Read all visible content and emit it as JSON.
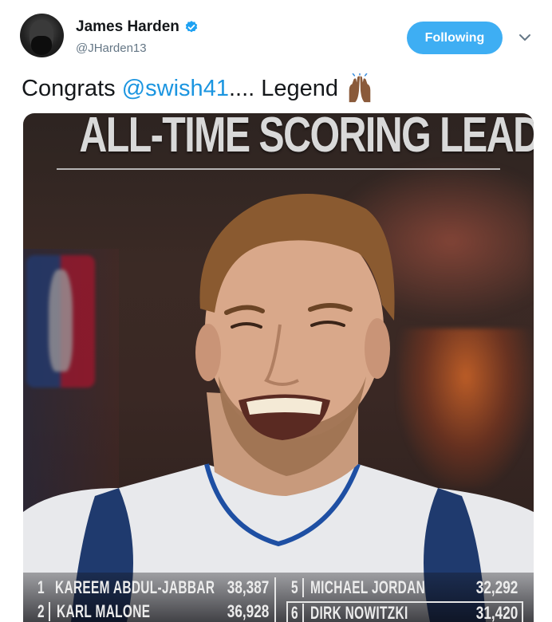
{
  "tweet": {
    "author_name": "James Harden",
    "author_handle": "@JHarden13",
    "follow_label": "Following",
    "text_before": "Congrats ",
    "mention": "@swish41",
    "text_after": ".... Legend"
  },
  "colors": {
    "accent": "#1da1f2",
    "mention": "#1b95e0",
    "handle_gray": "#657786"
  },
  "icons": {
    "verified": "verified-badge-icon",
    "caret": "chevron-down-icon",
    "emoji": "raised-hands-emoji"
  },
  "graphic": {
    "headline": "ALL-TIME SCORING LEADERS",
    "leaders_left": [
      {
        "rank": "1",
        "name": "KAREEM ABDUL-JABBAR",
        "points": "38,387"
      },
      {
        "rank": "2",
        "name": "KARL MALONE",
        "points": "36,928"
      }
    ],
    "leaders_right": [
      {
        "rank": "5",
        "name": "MICHAEL JORDAN",
        "points": "32,292"
      },
      {
        "rank": "6",
        "name": "DIRK NOWITZKI",
        "points": "31,420"
      }
    ]
  }
}
